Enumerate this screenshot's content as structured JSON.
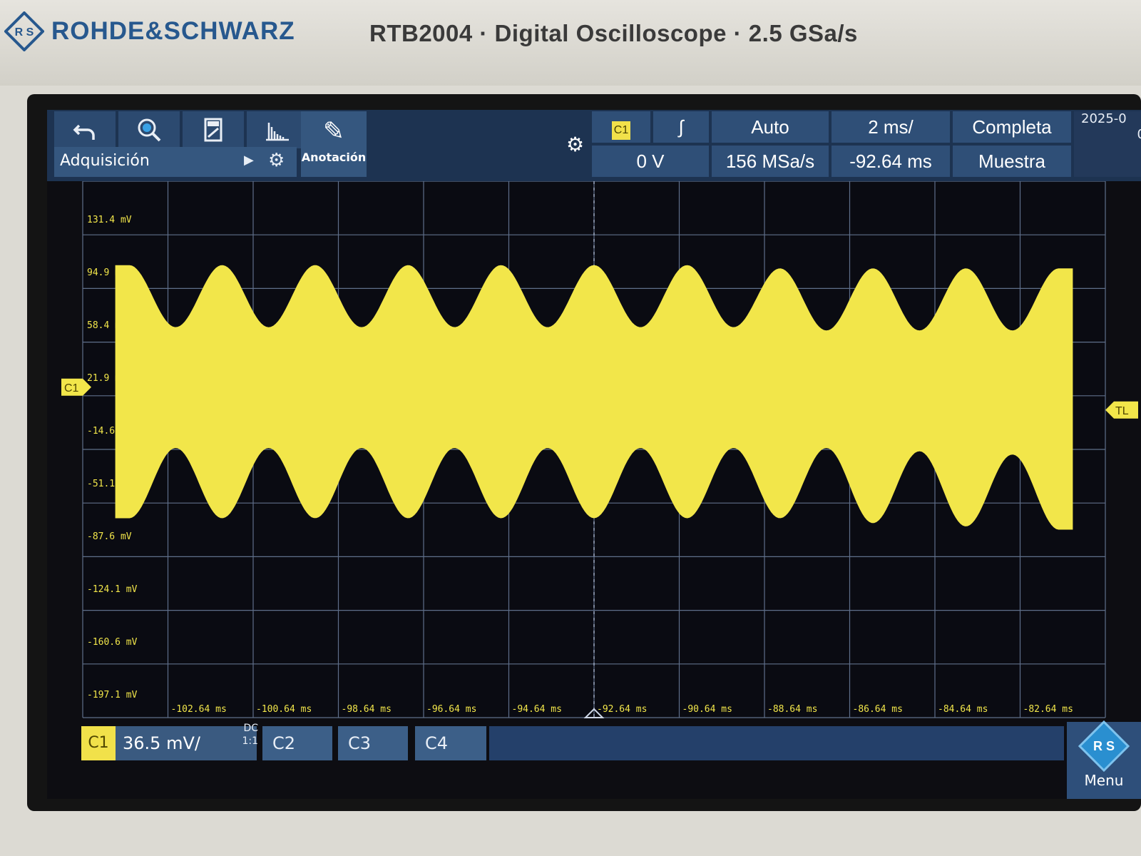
{
  "instrument": {
    "brand": "ROHDE&SCHWARZ",
    "model": "RTB2004 · Digital Oscilloscope · 2.5 GSa/s"
  },
  "toolbar": {
    "acquisition_label": "Adquisición",
    "annotation_label": "Anotación",
    "icons": [
      "undo-icon",
      "zoom-icon",
      "save-icon",
      "histogram-icon",
      "pencil-icon",
      "gear-icon"
    ]
  },
  "trigger": {
    "source": "C1",
    "level": "0 V",
    "mode": "Auto",
    "sample_rate": "156 MSa/s",
    "timebase": "2 ms/",
    "position": "-92.64 ms",
    "acq_mode": "Completa",
    "acq_sub": "Muestra",
    "date": "2025-0",
    "time": "0"
  },
  "grid": {
    "y_labels": [
      "131.4 mV",
      "94.9 mV",
      "58.4 mV",
      "21.9 mV",
      "-14.6 mV",
      "-51.1 mV",
      "-87.6 mV",
      "-124.1 mV",
      "-160.6 mV",
      "-197.1 mV"
    ],
    "x_labels": [
      "-102.64 ms",
      "-100.64 ms",
      "-98.64 ms",
      "-96.64 ms",
      "-94.64 ms",
      "-92.64 ms",
      "-90.64 ms",
      "-88.64 ms",
      "-86.64 ms",
      "-84.64 ms",
      "-82.64 ms"
    ],
    "c1_marker": "C1",
    "tl_marker": "TL"
  },
  "channels": {
    "c1": {
      "label": "C1",
      "scale": "36.5 mV/",
      "coupling": "DC",
      "probe": "1:1"
    },
    "c2": {
      "label": "C2"
    },
    "c3": {
      "label": "C3"
    },
    "c4": {
      "label": "C4"
    }
  },
  "menu": {
    "label": "Menu"
  },
  "colors": {
    "trace": "#f2e64a",
    "grid": "#5f6f8a",
    "toolbar": "#2f4f77",
    "brand": "#27588e"
  },
  "chart_data": {
    "type": "line",
    "title": "",
    "xlabel": "",
    "ylabel": "",
    "xlim": [
      -103.64,
      -81.64
    ],
    "ylim": [
      -197.1,
      131.4
    ],
    "grid": true,
    "series": [
      {
        "x": [
          -102.64,
          -101.64,
          -100.64,
          -99.64,
          -98.64,
          -97.64,
          -96.64,
          -95.64,
          -94.64,
          -93.64,
          -92.64,
          -91.64,
          -90.64,
          -89.64,
          -88.64,
          -87.64,
          -86.64,
          -85.64,
          -84.64,
          -83.64,
          -82.64
        ],
        "envelope_upper": [
          80,
          42,
          80,
          42,
          80,
          42,
          80,
          42,
          80,
          42,
          80,
          42,
          80,
          42,
          78,
          40,
          78,
          40,
          78,
          40,
          78
        ],
        "envelope_lower": [
          -75,
          -32,
          -75,
          -32,
          -75,
          -32,
          -75,
          -32,
          -75,
          -32,
          -75,
          -32,
          -75,
          -32,
          -75,
          -32,
          -78,
          -34,
          -80,
          -36,
          -82
        ]
      }
    ]
  }
}
